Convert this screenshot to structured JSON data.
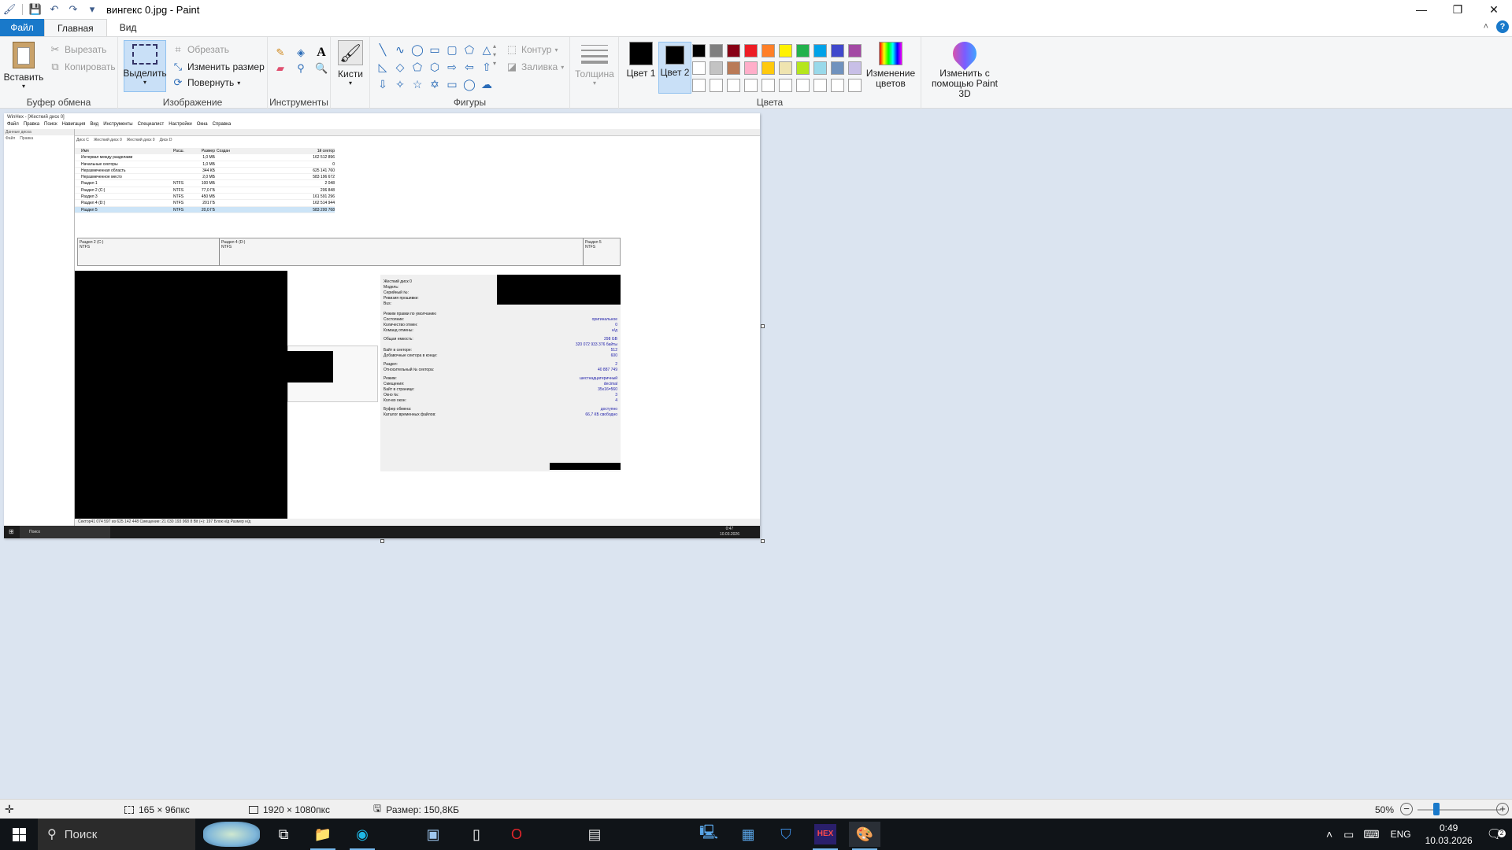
{
  "window": {
    "title": "вингекс 0.jpg - Paint"
  },
  "tabs": [
    "Файл",
    "Главная",
    "Вид"
  ],
  "ribbon": {
    "clipboard": {
      "label": "Буфер обмена",
      "paste": "Вставить",
      "cut": "Вырезать",
      "copy": "Копировать"
    },
    "image": {
      "label": "Изображение",
      "select": "Выделить",
      "crop": "Обрезать",
      "resize": "Изменить размер",
      "rotate": "Повернуть"
    },
    "tools": {
      "label": "Инструменты"
    },
    "brushes": {
      "label": "Кисти"
    },
    "shapes": {
      "label": "Фигуры",
      "outline": "Контур",
      "fill": "Заливка"
    },
    "size": {
      "label": "Толщина"
    },
    "colors": {
      "label": "Цвета",
      "color1": "Цвет 1",
      "color2": "Цвет 2",
      "edit": "Изменение цветов",
      "paint3d": "Изменить с помощью Paint 3D",
      "row1": [
        "#000000",
        "#7f7f7f",
        "#880015",
        "#ed1c24",
        "#ff7f27",
        "#fff200",
        "#22b14c",
        "#00a2e8",
        "#3f48cc",
        "#a349a4"
      ],
      "row2": [
        "#ffffff",
        "#c3c3c3",
        "#b97a57",
        "#ffaec9",
        "#ffc90e",
        "#efe4b0",
        "#b5e61d",
        "#99d9ea",
        "#7092be",
        "#c8bfe7"
      ],
      "row3": [
        "#ffffff",
        "#ffffff",
        "#ffffff",
        "#ffffff",
        "#ffffff",
        "#ffffff",
        "#ffffff",
        "#ffffff",
        "#ffffff",
        "#ffffff"
      ]
    }
  },
  "inner": {
    "title": "WinHex - [Жесткий диск 0]",
    "menu": [
      "Файл",
      "Правка",
      "Поиск",
      "Навигация",
      "Вид",
      "Инструменты",
      "Специалист",
      "Настройки",
      "Окна",
      "Справка"
    ],
    "left_items": [
      "Данные диска",
      "Файл",
      "Правка"
    ],
    "tabs": [
      "Диск C",
      "Жесткий диск 0",
      "Жесткий диск 0",
      "Диск D"
    ],
    "table_header": [
      "Имя",
      "Расш.",
      "Размер",
      "Создан",
      "Изменен",
      "Обновление записи",
      "Атр.",
      "1й сектор"
    ],
    "rows": [
      {
        "name": "Интервал между разделами",
        "ext": "",
        "size": "1,0 МБ",
        "sector": "162 512 896"
      },
      {
        "name": "Начальные секторы",
        "ext": "",
        "size": "1,0 МБ",
        "sector": "0"
      },
      {
        "name": "Неразмеченная область",
        "ext": "",
        "size": "344 КБ",
        "sector": "625 141 760"
      },
      {
        "name": "Неразмеченное место",
        "ext": "",
        "size": "2,0 МБ",
        "sector": "583 196 672"
      },
      {
        "name": "Раздел 1",
        "ext": "NTFS",
        "size": "100 МБ",
        "sector": "2 048"
      },
      {
        "name": "Раздел 2 (C:)",
        "ext": "NTFS",
        "size": "77,0 ГБ",
        "sector": "206 848"
      },
      {
        "name": "Раздел 3",
        "ext": "NTFS",
        "size": "450 МБ",
        "sector": "161 591 296"
      },
      {
        "name": "Раздел 4 (D:)",
        "ext": "NTFS",
        "size": "201 ГБ",
        "sector": "162 514 944"
      },
      {
        "name": "Раздел 5",
        "ext": "NTFS",
        "size": "20,0 ГБ",
        "sector": "583 200 768"
      }
    ],
    "parts": [
      {
        "label": "Раздел 2 (C:)",
        "fs": "NTFS"
      },
      {
        "label": "Раздел 4 (D:)",
        "fs": "NTFS"
      },
      {
        "label": "Раздел 5",
        "fs": "NTFS"
      }
    ],
    "props": [
      {
        "k": "Жесткий диск 0",
        "v": ""
      },
      {
        "k": "Модель:",
        "v": ""
      },
      {
        "k": "Серийный №:",
        "v": ""
      },
      {
        "k": "Ревизия прошивки:",
        "v": ""
      },
      {
        "k": "Bus:",
        "v": ""
      },
      {
        "k": "Режим правки по умолчанию",
        "v": ""
      },
      {
        "k": "Состояние:",
        "v": "оригинальное"
      },
      {
        "k": "Количество отмен:",
        "v": "0"
      },
      {
        "k": "Команд отмены:",
        "v": "н/д"
      },
      {
        "k": "Общая емкость:",
        "v": "298 GB"
      },
      {
        "k": "",
        "v": "320 072 933 376 байты"
      },
      {
        "k": "Байт в секторе:",
        "v": "512"
      },
      {
        "k": "Добавочные сектора в конце:",
        "v": "600"
      },
      {
        "k": "Раздел:",
        "v": "2"
      },
      {
        "k": "Относительный № сектора:",
        "v": "40 887 749"
      },
      {
        "k": "Режим:",
        "v": "шестнадцатеричный"
      },
      {
        "k": "Смещения:",
        "v": "decimal"
      },
      {
        "k": "Байт в странице:",
        "v": "35x16=560"
      },
      {
        "k": "Окно №:",
        "v": "3"
      },
      {
        "k": "Кол-во окон:",
        "v": "4"
      },
      {
        "k": "Буфер обмена:",
        "v": "доступно"
      },
      {
        "k": "Каталог временных файлов:",
        "v": "66,7 КБ свободно"
      }
    ],
    "status": "Сектор41 074 597 из 625 142 448    Смещение: 21 030 193 968    8 Bit (+): 197    Блок н/д    Размер н/д",
    "taskbar_search": "Поиск",
    "taskbar_time": "0:47",
    "taskbar_date": "10.03.2026"
  },
  "statusbar": {
    "selection": "165 × 96пкс",
    "dimensions": "1920 × 1080пкс",
    "filesize": "Размер: 150,8КБ",
    "zoom": "50%",
    "zoom_level": 0.5
  },
  "taskbar": {
    "search": "Поиск",
    "lang": "ENG",
    "time": "0:49",
    "date": "10.03.2026"
  }
}
